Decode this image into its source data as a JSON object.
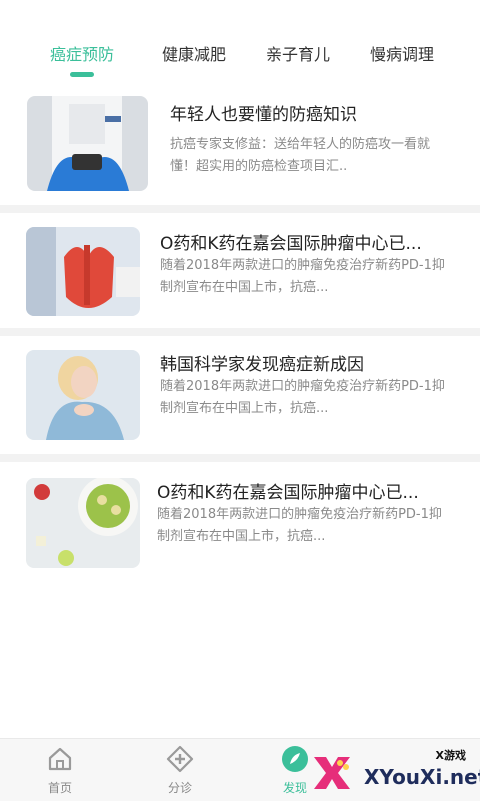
{
  "tabs": [
    {
      "label": "癌症预防",
      "active": true
    },
    {
      "label": "健康减肥",
      "active": false
    },
    {
      "label": "亲子育儿",
      "active": false
    },
    {
      "label": "慢病调理",
      "active": false
    }
  ],
  "articles": [
    {
      "title": "年轻人也要懂的防癌知识",
      "desc": "抗癌专家支修益：送给年轻人的防癌攻一看就懂！超实用的防癌检查项目汇.."
    },
    {
      "title": "O药和K药在嘉会国际肿瘤中心已...",
      "desc": "随着2018年两款进口的肿瘤免疫治疗新药PD-1抑制剂宣布在中国上市，抗癌..."
    },
    {
      "title": "韩国科学家发现癌症新成因",
      "desc": "随着2018年两款进口的肿瘤免疫治疗新药PD-1抑制剂宣布在中国上市，抗癌..."
    },
    {
      "title": "O药和K药在嘉会国际肿瘤中心已...",
      "desc": "随着2018年两款进口的肿瘤免疫治疗新药PD-1抑制剂宣布在中国上市，抗癌..."
    }
  ],
  "bottom_nav": [
    {
      "label": "首页",
      "icon": "home-icon",
      "active": false
    },
    {
      "label": "分诊",
      "icon": "triage-icon",
      "active": false
    },
    {
      "label": "发现",
      "icon": "discover-icon",
      "active": true
    }
  ],
  "watermark": {
    "brand": "XYouXi.net",
    "sub": "X游戏"
  },
  "colors": {
    "accent": "#3bbf9a",
    "text": "#222222",
    "muted": "#8a8a8a"
  }
}
